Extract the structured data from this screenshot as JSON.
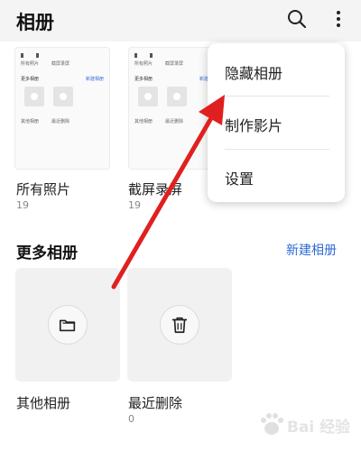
{
  "header": {
    "title": "相册",
    "search_icon": "search-icon",
    "more_icon": "more-vertical-icon"
  },
  "albums": [
    {
      "name": "所有照片",
      "count": "19"
    },
    {
      "name": "截屏录屏",
      "count": "19"
    }
  ],
  "thumbnail_preview": {
    "row1": [
      "所有照片",
      "截屏录屏"
    ],
    "section": "更多相册",
    "section_link": "新建相册",
    "tiles": [
      "其他相册",
      "最近删除"
    ]
  },
  "more_section": {
    "title": "更多相册",
    "new_album": "新建相册",
    "items": [
      {
        "name": "其他相册",
        "count": "",
        "icon": "folder-icon"
      },
      {
        "name": "最近删除",
        "count": "0",
        "icon": "trash-icon"
      }
    ]
  },
  "menu": {
    "items": [
      {
        "label": "隐藏相册"
      },
      {
        "label": "制作影片"
      },
      {
        "label": "设置"
      }
    ]
  },
  "watermark": {
    "text": "Bai 经验"
  },
  "colors": {
    "accent": "#2f6bd6",
    "annotation_arrow": "#e02020"
  }
}
